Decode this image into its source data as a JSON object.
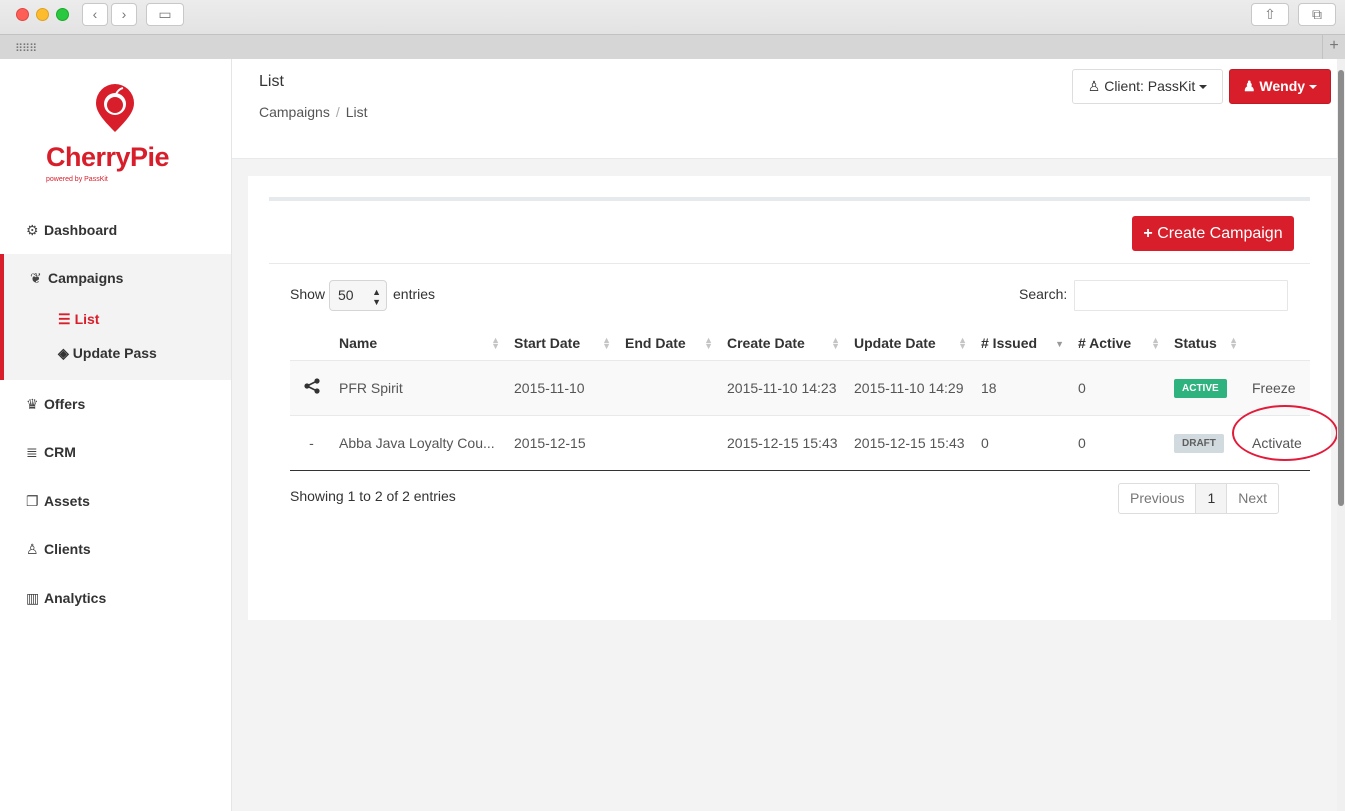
{
  "browser": {
    "back": "‹",
    "forward": "›",
    "sidebar_toggle": "▭",
    "share": "⇧",
    "tabs": "⧉",
    "apps_grid": "⠿⠿⠿",
    "new_tab": "+"
  },
  "brand": {
    "name": "CherryPie",
    "tagline": "powered by PassKit",
    "color": "#d81e2b"
  },
  "sidebar": {
    "items": [
      {
        "icon": "⚙",
        "label": "Dashboard"
      },
      {
        "icon": "❦",
        "label": "Campaigns"
      },
      {
        "icon": "♛",
        "label": "Offers"
      },
      {
        "icon": "≣",
        "label": "CRM"
      },
      {
        "icon": "❐",
        "label": "Assets"
      },
      {
        "icon": "♙",
        "label": "Clients"
      },
      {
        "icon": "▥",
        "label": "Analytics"
      }
    ],
    "sub_items": [
      {
        "icon": "☰",
        "label": "List"
      },
      {
        "icon": "◈",
        "label": "Update Pass"
      }
    ]
  },
  "header": {
    "title": "List",
    "breadcrumb": [
      "Campaigns",
      "/",
      "List"
    ],
    "client_button": "Client: PassKit",
    "client_icon": "♙",
    "user_button": "Wendy",
    "user_icon": "♟"
  },
  "toolbar": {
    "create_label": "Create Campaign",
    "create_icon": "+"
  },
  "table_controls": {
    "show_label": "Show",
    "page_size": "50",
    "entries_label": "entries",
    "search_label": "Search:",
    "search_value": ""
  },
  "table": {
    "columns": [
      "Name",
      "Start Date",
      "End Date",
      "Create Date",
      "Update Date",
      "# Issued",
      "# Active",
      "Status"
    ],
    "rows": [
      {
        "lead": "share",
        "name": "PFR Spirit",
        "start": "2015-11-10",
        "end": "",
        "created": "2015-11-10 14:23",
        "updated": "2015-11-10 14:29",
        "issued": "18",
        "active": "0",
        "status": "ACTIVE",
        "action": "Freeze"
      },
      {
        "lead": "-",
        "name": "Abba Java Loyalty Cou...",
        "start": "2015-12-15",
        "end": "",
        "created": "2015-12-15 15:43",
        "updated": "2015-12-15 15:43",
        "issued": "0",
        "active": "0",
        "status": "DRAFT",
        "action": "Activate"
      }
    ]
  },
  "footer": {
    "showing": "Showing 1 to 2 of 2 entries",
    "previous": "Previous",
    "page": "1",
    "next": "Next"
  },
  "colors": {
    "accent": "#d81e2b",
    "active_badge": "#2eb37e",
    "draft_badge": "#d1dade",
    "highlight_circle": "#e21b3a"
  }
}
